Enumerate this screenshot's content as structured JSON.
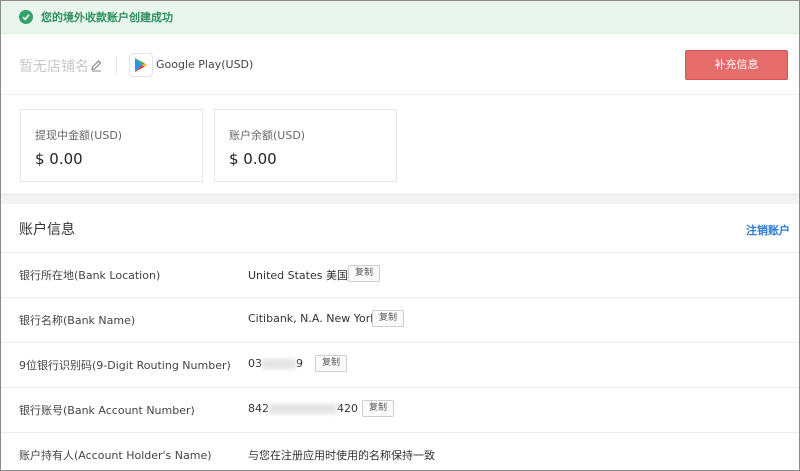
{
  "banner": {
    "text": "您的境外收款账户创建成功",
    "icon": "check-circle-icon",
    "color": "#34a36b"
  },
  "shop": {
    "name": "暂无店铺名",
    "platform_icon": "google-play-icon",
    "platform_label": "Google Play(USD)",
    "supplement_button": "补充信息"
  },
  "stats": [
    {
      "label": "提现中金额(USD)",
      "value": "$ 0.00"
    },
    {
      "label": "账户余额(USD)",
      "value": "$ 0.00"
    }
  ],
  "account": {
    "title": "账户信息",
    "cancel_link": "注销账户",
    "copy_label": "复制",
    "rows": [
      {
        "label": "银行所在地(Bank Location)",
        "value": "United States 美国"
      },
      {
        "label": "银行名称(Bank Name)",
        "value": "Citibank, N.A. New York"
      },
      {
        "label": "9位银行识别码(9-Digit Routing Number)",
        "value_prefix": "03",
        "value_suffix": "9"
      },
      {
        "label": "银行账号(Bank Account Number)",
        "value_prefix": "842",
        "value_suffix": "420"
      },
      {
        "label": "账户持有人(Account Holder's Name)",
        "value": "与您在注册应用时使用的名称保持一致"
      }
    ]
  },
  "colors": {
    "primary_button": "#e66b6b",
    "link": "#2e7ad1",
    "success": "#34a36b"
  }
}
